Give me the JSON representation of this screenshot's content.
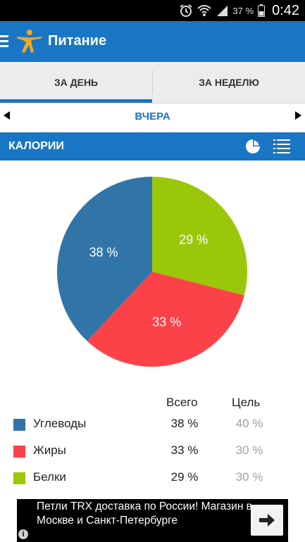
{
  "status_bar": {
    "battery_percent": "37 %",
    "time": "0:42"
  },
  "app_bar": {
    "title": "Питание"
  },
  "tabs": [
    {
      "label": "ЗА ДЕНЬ",
      "selected": true
    },
    {
      "label": "ЗА НЕДЕЛЮ",
      "selected": false
    }
  ],
  "day_nav": {
    "label": "ВЧЕРА"
  },
  "section": {
    "title": "КАЛОРИИ"
  },
  "table": {
    "header_total": "Всего",
    "header_goal": "Цель"
  },
  "chart_data": {
    "type": "pie",
    "slices": [
      {
        "name": "Углеводы",
        "value": 38,
        "label": "38 %",
        "goal": "40 %",
        "color": "#3174a8"
      },
      {
        "name": "Жиры",
        "value": 33,
        "label": "33 %",
        "goal": "30 %",
        "color": "#fb4248"
      },
      {
        "name": "Белки",
        "value": 29,
        "label": "29 %",
        "goal": "30 %",
        "color": "#9bc70a"
      }
    ]
  },
  "ad": {
    "text": "Петли TRX доставка по России! Магазин в Москве и Санкт-Петербурге",
    "info": "i"
  },
  "colors": {
    "accent": "#1976c4",
    "status_bar": "#000000",
    "goal_text": "#a0a0a0"
  }
}
